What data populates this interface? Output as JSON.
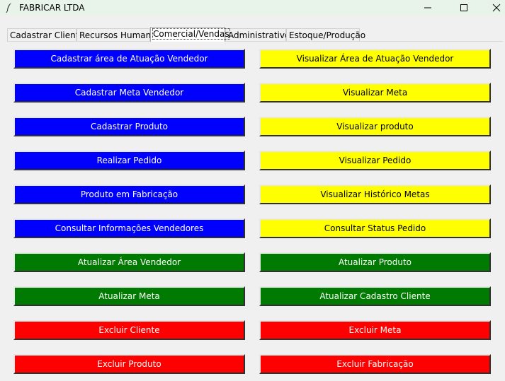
{
  "window": {
    "title": "FABRICAR LTDA",
    "icon": "feather-icon",
    "controls": [
      "minimize-icon",
      "maximize-icon",
      "close-icon"
    ]
  },
  "tabs": [
    {
      "label": "Cadastrar Cliente",
      "active": false
    },
    {
      "label": "Recursos Humano",
      "active": false
    },
    {
      "label": "Comercial/Vendas",
      "active": true
    },
    {
      "label": "Administrativo",
      "active": false
    },
    {
      "label": "Estoque/Produção",
      "active": false
    }
  ],
  "buttons": {
    "left": [
      {
        "label": "Cadastrar área de Atuação Vendedor",
        "color": "#0000ff"
      },
      {
        "label": "Cadastrar Meta Vendedor",
        "color": "#0000ff"
      },
      {
        "label": "Cadastrar Produto",
        "color": "#0000ff"
      },
      {
        "label": "Realizar Pedido",
        "color": "#0000ff"
      },
      {
        "label": "Produto em Fabricação",
        "color": "#0000ff"
      },
      {
        "label": "Consultar Informações Vendedores",
        "color": "#0000ff"
      },
      {
        "label": "Atualizar Área Vendedor",
        "color": "#007a00"
      },
      {
        "label": "Atualizar Meta",
        "color": "#007a00"
      },
      {
        "label": "Excluir Cliente",
        "color": "#ff0000"
      },
      {
        "label": "Excluir Produto",
        "color": "#ff0000"
      }
    ],
    "right": [
      {
        "label": "Visualizar Área de Atuação Vendedor",
        "color": "#ffff00"
      },
      {
        "label": "Visualizar Meta",
        "color": "#ffff00"
      },
      {
        "label": "Visualizar produto",
        "color": "#ffff00"
      },
      {
        "label": "Visualizar Pedido",
        "color": "#ffff00"
      },
      {
        "label": "Visualizar Histórico Metas",
        "color": "#ffff00"
      },
      {
        "label": "Consultar Status Pedido",
        "color": "#ffff00"
      },
      {
        "label": "Atualizar Produto",
        "color": "#007a00"
      },
      {
        "label": "Atualizar Cadastro Cliente",
        "color": "#007a00"
      },
      {
        "label": "Excluir Meta",
        "color": "#ff0000"
      },
      {
        "label": "Excluir Fabricação",
        "color": "#ff0000"
      }
    ]
  }
}
